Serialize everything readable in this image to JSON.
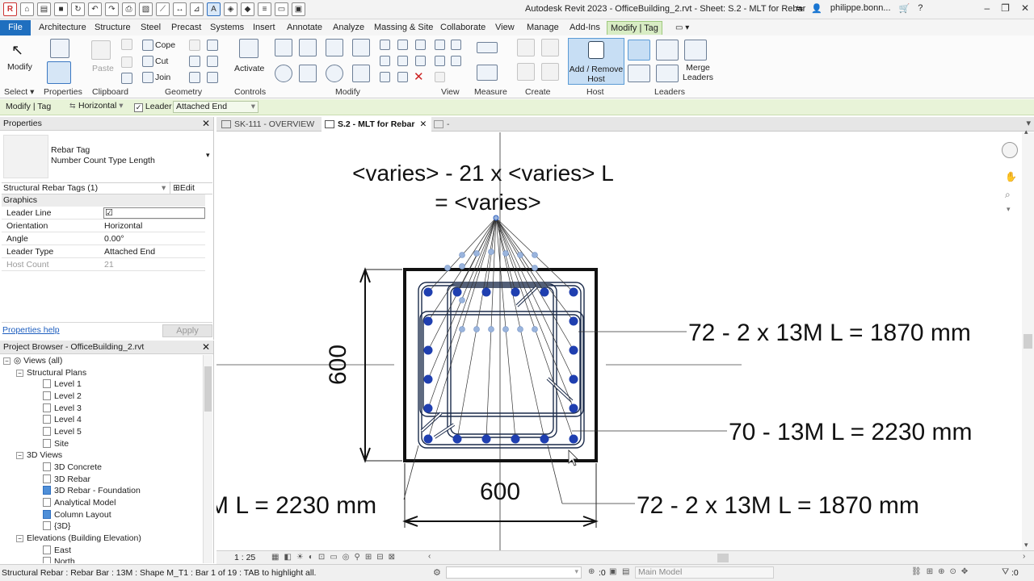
{
  "window": {
    "title": "Autodesk Revit 2023 - OfficeBuilding_2.rvt - Sheet: S.2 - MLT for Rebar",
    "user": "philippe.bonn...",
    "help": "?"
  },
  "ribbon_tabs": [
    "File",
    "Architecture",
    "Structure",
    "Steel",
    "Precast",
    "Systems",
    "Insert",
    "Annotate",
    "Analyze",
    "Massing & Site",
    "Collaborate",
    "View",
    "Manage",
    "Add-Ins",
    "Modify | Tag"
  ],
  "ribbon": {
    "modify_label": "Modify",
    "paste_label": "Paste",
    "cope_label": "Cope",
    "cut_label": "Cut",
    "join_label": "Join",
    "activate_label": "Activate",
    "add_remove_host_label": "Add / Remove Host",
    "merge_leaders_label": "Merge Leaders",
    "panels": {
      "select": "Select",
      "properties": "Properties",
      "clipboard": "Clipboard",
      "geometry": "Geometry",
      "controls": "Controls",
      "modify": "Modify",
      "view": "View",
      "measure": "Measure",
      "create": "Create",
      "host": "Host",
      "leaders": "Leaders"
    }
  },
  "options_bar": {
    "context": "Modify | Tag",
    "orientation": "Horizontal",
    "leader_label": "Leader",
    "leader_checked": true,
    "leader_type": "Attached End"
  },
  "properties": {
    "title": "Properties",
    "type_name": "Rebar Tag",
    "type_sub": "Number Count Type Length",
    "filter": "Structural Rebar Tags (1)",
    "edit_type": "Edit Type",
    "group": "Graphics",
    "rows": [
      {
        "key": "Leader Line",
        "value": ""
      },
      {
        "key": "Orientation",
        "value": "Horizontal"
      },
      {
        "key": "Angle",
        "value": "0.00°"
      },
      {
        "key": "Leader Type",
        "value": "Attached End"
      },
      {
        "key": "Host Count",
        "value": "21"
      }
    ],
    "help_link": "Properties help",
    "apply": "Apply"
  },
  "project_browser": {
    "title": "Project Browser - OfficeBuilding_2.rvt",
    "root": "Views (all)",
    "structural_plans": "Structural Plans",
    "plans": [
      "Level 1",
      "Level 2",
      "Level 3",
      "Level 4",
      "Level 5",
      "Site"
    ],
    "views_3d": "3D Views",
    "views3d_items": [
      "3D Concrete",
      "3D Rebar",
      "3D Rebar - Foundation",
      "Analytical Model",
      "Column Layout",
      "{3D}"
    ],
    "elevations": "Elevations (Building Elevation)",
    "elevation_items": [
      "East",
      "North"
    ]
  },
  "view_tabs": [
    "SK-111 - OVERVIEW",
    "S.2 - MLT for Rebar",
    "-"
  ],
  "drawing": {
    "tag_line1": "<varies> - 21 x <varies> L",
    "tag_line2": "= <varies>",
    "dim_vertical": "600",
    "dim_horizontal": "600",
    "label_right_top": "72 - 2 x 13M L = 1870 mm",
    "label_right_mid": "70 - 13M L = 2230 mm",
    "label_bottom_left": "M L = 2230 mm",
    "label_bottom_right": "72 - 2 x 13M L = 1870 mm",
    "colors": {
      "rebar": "#1f3fb0",
      "tag_dot": "#9ab4dc",
      "leader": "#333333"
    }
  },
  "view_bar": {
    "scale": "1 : 25"
  },
  "status": {
    "message": "Structural Rebar : Rebar Bar : 13M : Shape M_T1 : Bar 1 of 19 : TAB to highlight all.",
    "zero": ":0",
    "model": "Main Model",
    "filter_count": ":0"
  }
}
